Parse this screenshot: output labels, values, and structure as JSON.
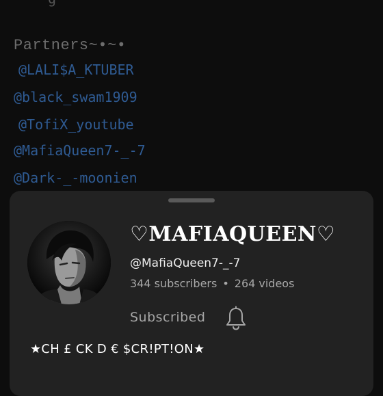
{
  "top_fragment": "g",
  "partners": {
    "title": "Partners~•~•",
    "items": [
      "@LALI$A_KTUBER",
      "@black_swam1909",
      "@TofiX_youtube",
      "@MafiaQueen7-_-7",
      "@Dark-_-moonien"
    ]
  },
  "channel": {
    "name": "♡MAFIAQUEEN♡",
    "handle": "@MafiaQueen7-_-7",
    "subscribers": "344 subscribers",
    "separator": "•",
    "videos": "264 videos",
    "subscribe_label": "Subscribed",
    "description": "★CH £ CK D € $CR!PT!ON★",
    "avatar_icon": "profile-photo",
    "bell_icon": "notification-bell-icon"
  },
  "colors": {
    "background": "#0d0d0d",
    "sheet": "#222222",
    "partner_link": "#2f5b93",
    "muted_text": "#a8a8a8"
  }
}
